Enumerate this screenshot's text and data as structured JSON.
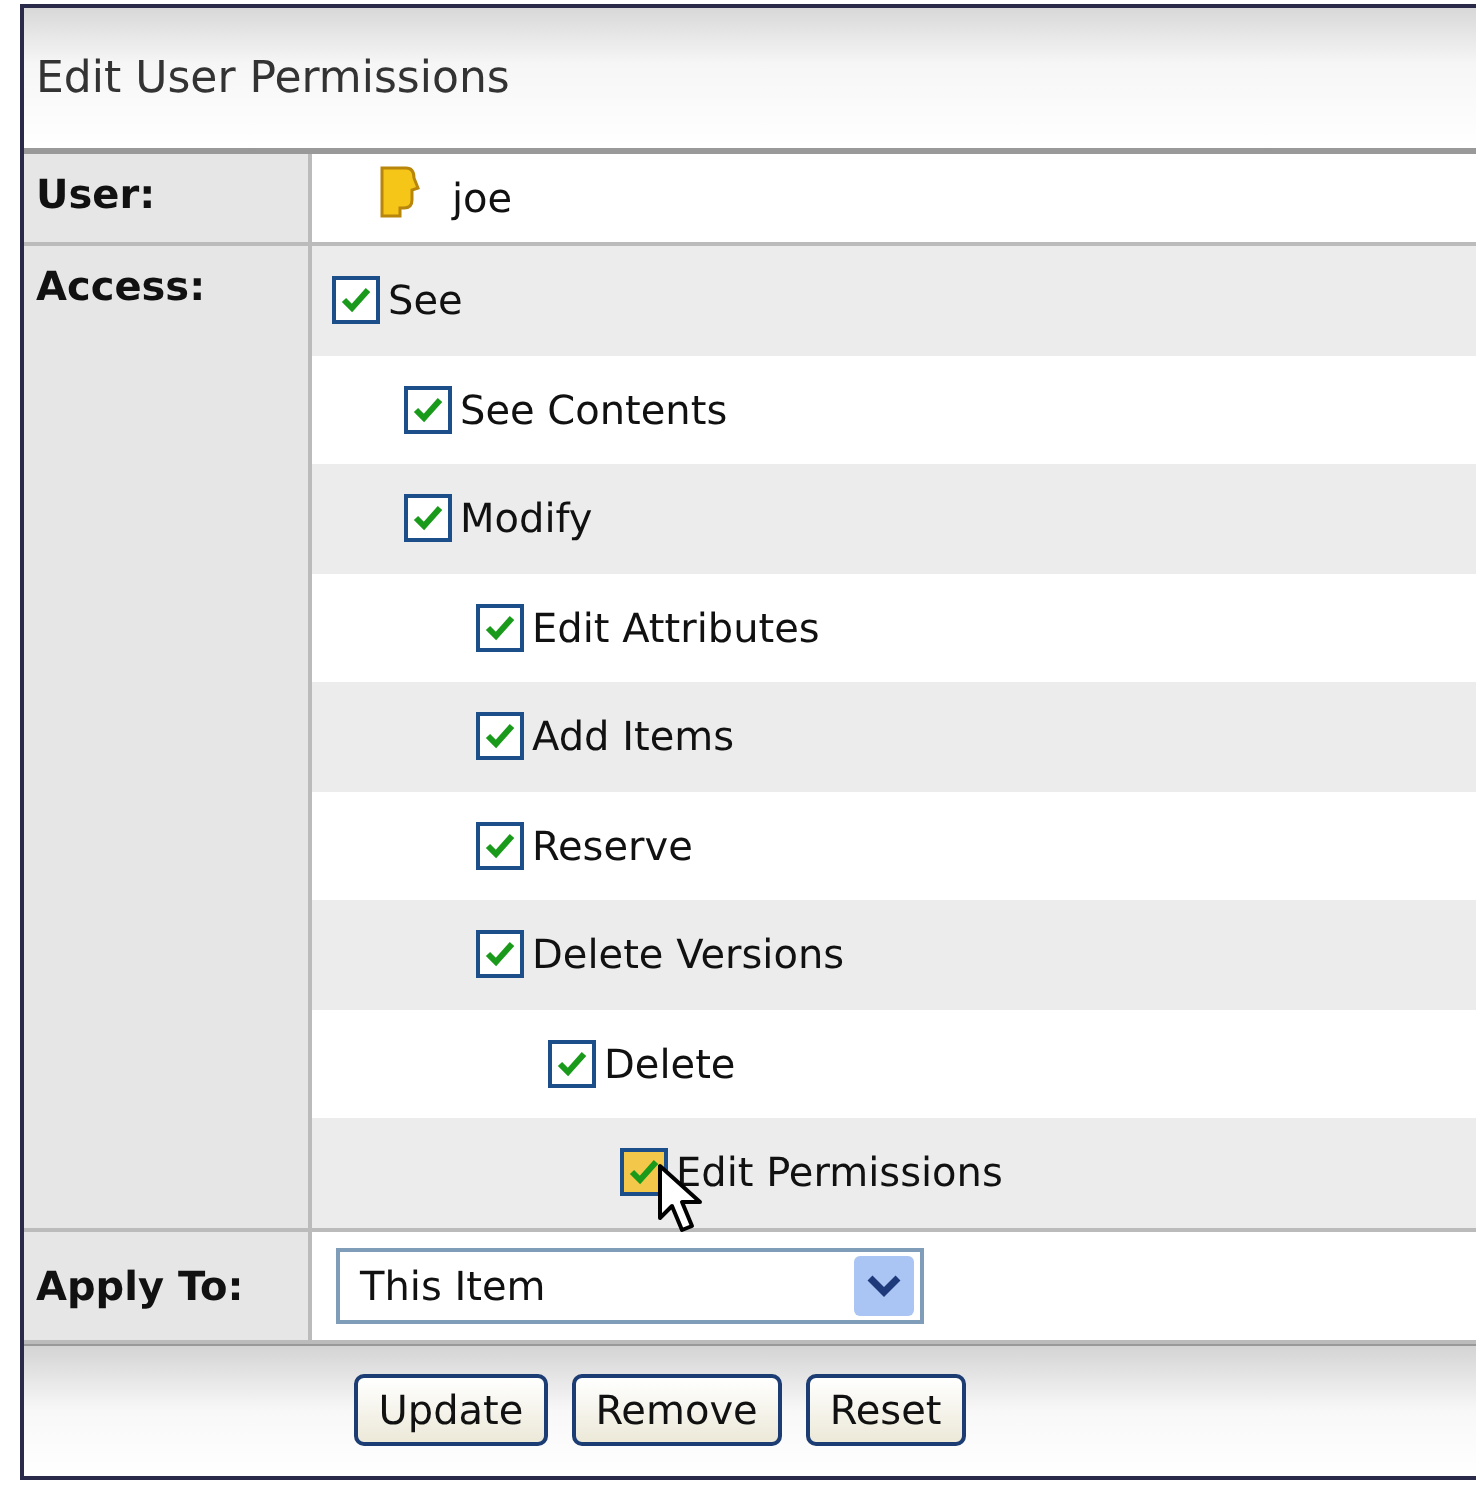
{
  "title": "Edit User Permissions",
  "user": {
    "label": "User:",
    "name": "joe"
  },
  "access": {
    "label": "Access:",
    "items": [
      {
        "label": "See",
        "checked": true,
        "hovered": false,
        "children": [
          {
            "label": "See Contents",
            "checked": true,
            "hovered": false
          },
          {
            "label": "Modify",
            "checked": true,
            "hovered": false,
            "children": [
              {
                "label": "Edit Attributes",
                "checked": true,
                "hovered": false
              },
              {
                "label": "Add Items",
                "checked": true,
                "hovered": false
              },
              {
                "label": "Reserve",
                "checked": true,
                "hovered": false
              },
              {
                "label": "Delete Versions",
                "checked": true,
                "hovered": false,
                "children": [
                  {
                    "label": "Delete",
                    "checked": true,
                    "hovered": false,
                    "children": [
                      {
                        "label": "Edit Permissions",
                        "checked": true,
                        "hovered": true
                      }
                    ]
                  }
                ]
              }
            ]
          }
        ]
      }
    ]
  },
  "apply_to": {
    "label": "Apply To:",
    "value": "This Item"
  },
  "buttons": [
    "Update",
    "Remove",
    "Reset"
  ]
}
